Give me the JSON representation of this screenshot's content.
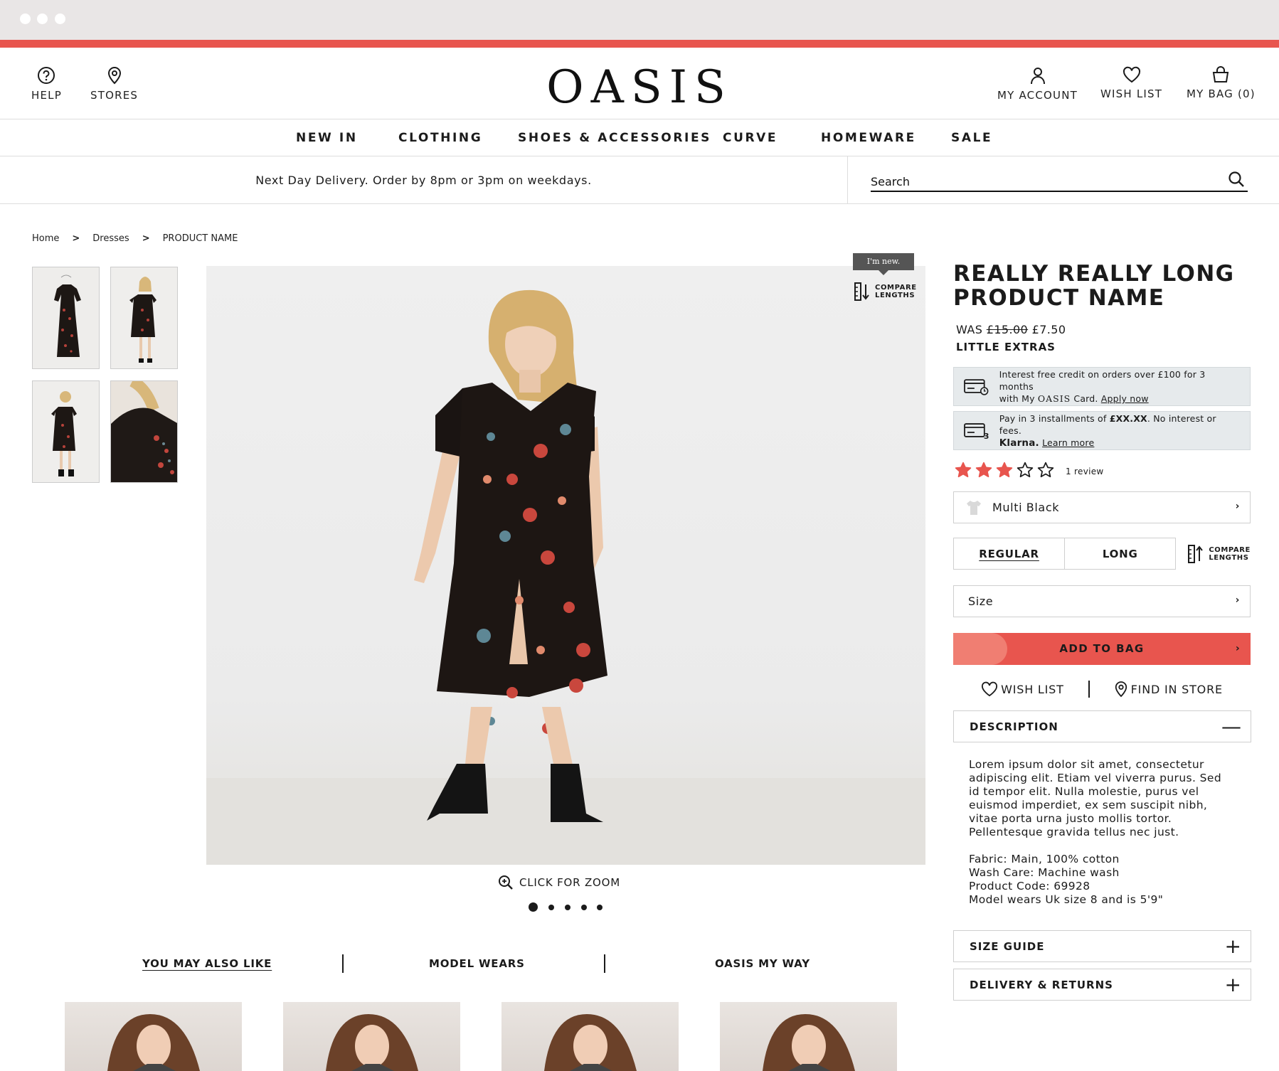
{
  "header": {
    "help_label": "HELP",
    "stores_label": "STORES",
    "logo": "OASIS",
    "account_label": "MY ACCOUNT",
    "wishlist_label": "WISH LIST",
    "bag_label": "MY BAG (0)"
  },
  "nav": {
    "items": [
      "NEW IN",
      "CLOTHING",
      "SHOES & ACCESSORIES",
      "CURVE",
      "HOMEWARE",
      "SALE"
    ]
  },
  "promo": {
    "text": "Next Day Delivery. Order by 8pm or 3pm on weekdays."
  },
  "search": {
    "placeholder": "Search"
  },
  "breadcrumb": {
    "items": [
      "Home",
      "Dresses",
      "PRODUCT NAME"
    ],
    "separator": ">"
  },
  "gallery": {
    "new_tag": "I'm new.",
    "compare_line1": "COMPARE",
    "compare_line2": "LENGTHS",
    "zoom_label": "CLICK FOR ZOOM",
    "dots_count": 5,
    "active_dot": 1
  },
  "product": {
    "name_line1": "REALLY REALLY LONG",
    "name_line2": "PRODUCT NAME",
    "was_label": "WAS",
    "was_price": "£15.00",
    "now_price": "£7.50",
    "category": "LITTLE EXTRAS",
    "credit_text1": "Interest free credit on orders over £100 for 3 months",
    "credit_text2_pre": "with My",
    "credit_brand": "OASIS",
    "credit_text2_post": "Card.",
    "credit_link": "Apply now",
    "klarna_pre": "Pay in 3 installments of",
    "klarna_amount": "£XX.XX",
    "klarna_post": ". No interest or fees.",
    "klarna_brand": "Klarna.",
    "klarna_link": "Learn more",
    "rating": 3,
    "rating_max": 5,
    "review_count": "1 review",
    "colour": "Multi Black",
    "length_options": [
      "REGULAR",
      "LONG"
    ],
    "length_selected": "REGULAR",
    "size_label": "Size",
    "add_to_bag": "ADD TO BAG",
    "wish_list_label": "WISH LIST",
    "find_in_store_label": "FIND IN STORE",
    "description_title": "DESCRIPTION",
    "description_text": "Lorem ipsum dolor sit amet, consectetur adipiscing elit. Etiam vel viverra purus. Sed id tempor elit. Nulla molestie, purus vel euismod imperdiet, ex sem suscipit nibh, vitae porta urna justo mollis tortor. Pellentesque gravida tellus nec just.",
    "fabric": "Fabric: Main, 100% cotton",
    "wash_care": "Wash Care: Machine wash",
    "product_code": "Product Code: 69928",
    "model_info": "Model wears Uk size 8 and is 5'9\"",
    "size_guide": "SIZE GUIDE",
    "delivery_returns": "DELIVERY & RETURNS"
  },
  "recommendations": {
    "tabs": [
      "YOU MAY ALSO LIKE",
      "MODEL WEARS",
      "OASIS MY WAY"
    ],
    "active_tab": "YOU MAY ALSO LIKE"
  },
  "colors": {
    "accent": "#e8554e",
    "star": "#e8554e",
    "info_bg": "#e6eaec"
  }
}
